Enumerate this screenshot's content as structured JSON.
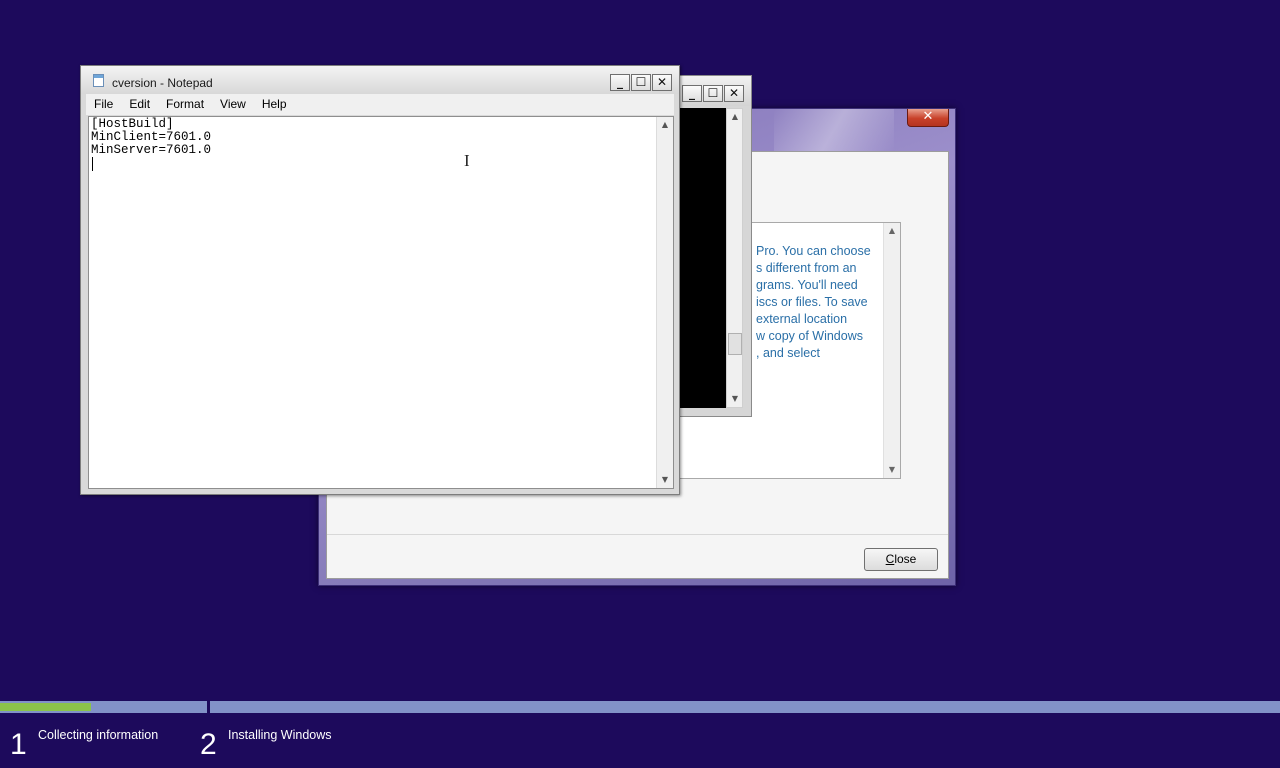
{
  "setup_dialog": {
    "close_glyph": "✕",
    "description_lines": [
      "Pro. You can choose",
      "s different from an",
      "grams. You'll need",
      "iscs or files. To save",
      "external location",
      "w copy of Windows",
      ", and select"
    ],
    "close_button_accel": "C",
    "close_button_rest": "lose"
  },
  "console_window": {
    "minimize_glyph": "_",
    "maximize_glyph": "☐",
    "close_glyph": "✕"
  },
  "notepad": {
    "title": "cversion - Notepad",
    "menu": [
      "File",
      "Edit",
      "Format",
      "View",
      "Help"
    ],
    "lines": [
      "[HostBuild]",
      "MinClient=7601.0",
      "MinServer=7601.0"
    ],
    "minimize_glyph": "_",
    "maximize_glyph": "☐",
    "close_glyph": "✕",
    "cursor_glyph": "I"
  },
  "setup_progress": {
    "fill_fraction": 0.44,
    "steps": [
      {
        "number": "1",
        "label": "Collecting information"
      },
      {
        "number": "2",
        "label": "Installing Windows"
      }
    ]
  },
  "colors": {
    "desktop": "#1d0a5c",
    "progress_fill": "#8bc34a",
    "link_text": "#2a6fa7"
  }
}
